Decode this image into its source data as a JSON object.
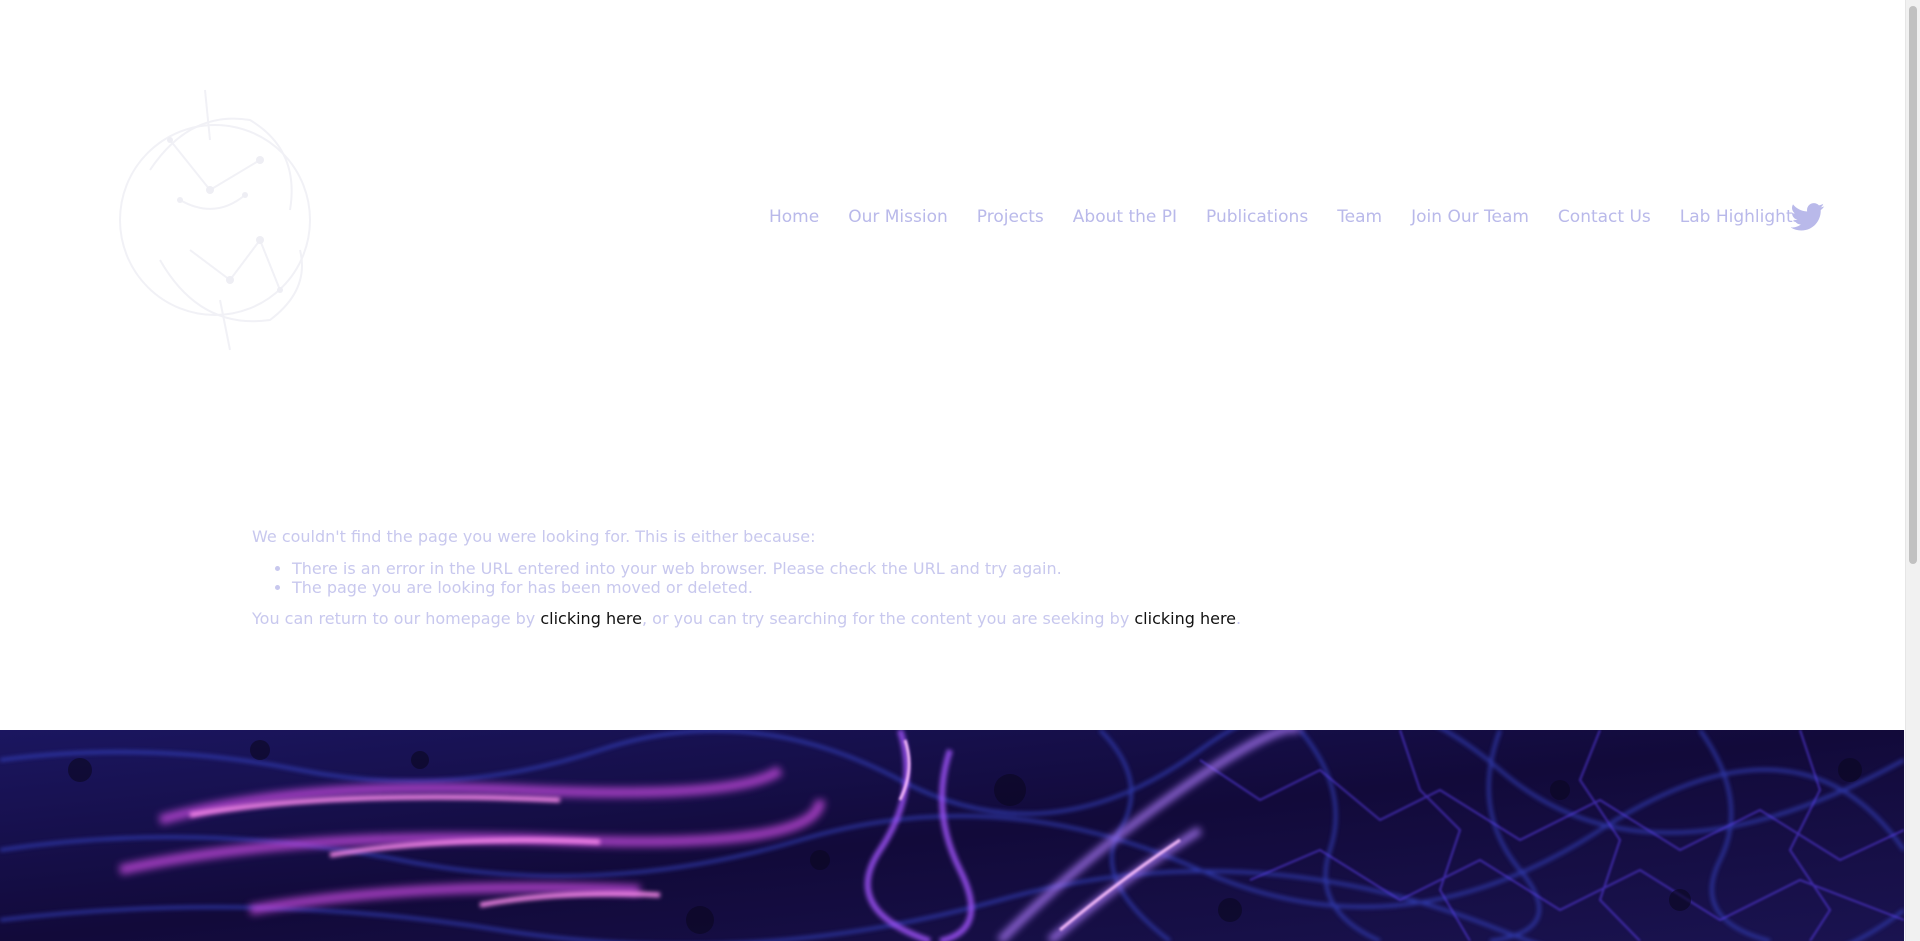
{
  "nav": {
    "items": [
      "Home",
      "Our Mission",
      "Projects",
      "About the PI",
      "Publications",
      "Team",
      "Join Our Team",
      "Contact Us",
      "Lab Highlights"
    ]
  },
  "icons": {
    "logo": "lab-logo-icon",
    "twitter": "twitter-icon"
  },
  "colors": {
    "nav_text": "#b9b9ea",
    "body_text": "#c8c8ee",
    "link_text": "#111111",
    "hero_base": "#120a3a"
  },
  "error": {
    "intro": "We couldn't find the page you were looking for. This is either because:",
    "reasons": [
      "There is an error in the URL entered into your web browser. Please check the URL and try again.",
      "The page you are looking for has been moved or deleted."
    ],
    "return_prefix": "You can return to our homepage by ",
    "homepage_link": "clicking here",
    "return_middle": ", or you can try searching for the content you are seeking by ",
    "search_link": "clicking here",
    "return_suffix": "."
  }
}
